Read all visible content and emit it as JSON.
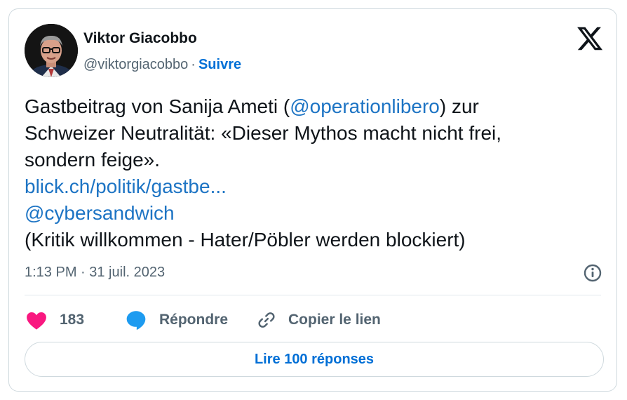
{
  "author": {
    "name": "Viktor Giacobbo",
    "handle": "@viktorgiacobbo",
    "separator": "·",
    "follow_label": "Suivre"
  },
  "tweet": {
    "line1_pre": "Gastbeitrag von Sanija Ameti (",
    "mention1": "@operationlibero",
    "line1_post": ") zur",
    "line2": "Schweizer Neutralität: «Dieser Mythos macht nicht frei,",
    "line3": "sondern feige».",
    "link": "blick.ch/politik/gastbe...",
    "mention2": "@cybersandwich",
    "line6": "(Kritik willkommen - Hater/Pöbler werden blockiert)"
  },
  "meta": {
    "timestamp": "1:13 PM · 31 juil. 2023"
  },
  "actions": {
    "likes": "183",
    "reply_label": "Répondre",
    "copy_label": "Copier le lien"
  },
  "read_replies_label": "Lire 100 réponses",
  "colors": {
    "like": "#f91880",
    "reply": "#1d9bf0",
    "link": "#1d74c4",
    "muted": "#536471"
  },
  "icons": [
    "x-logo-icon",
    "info-icon",
    "heart-icon",
    "reply-bubble-icon",
    "link-icon"
  ]
}
